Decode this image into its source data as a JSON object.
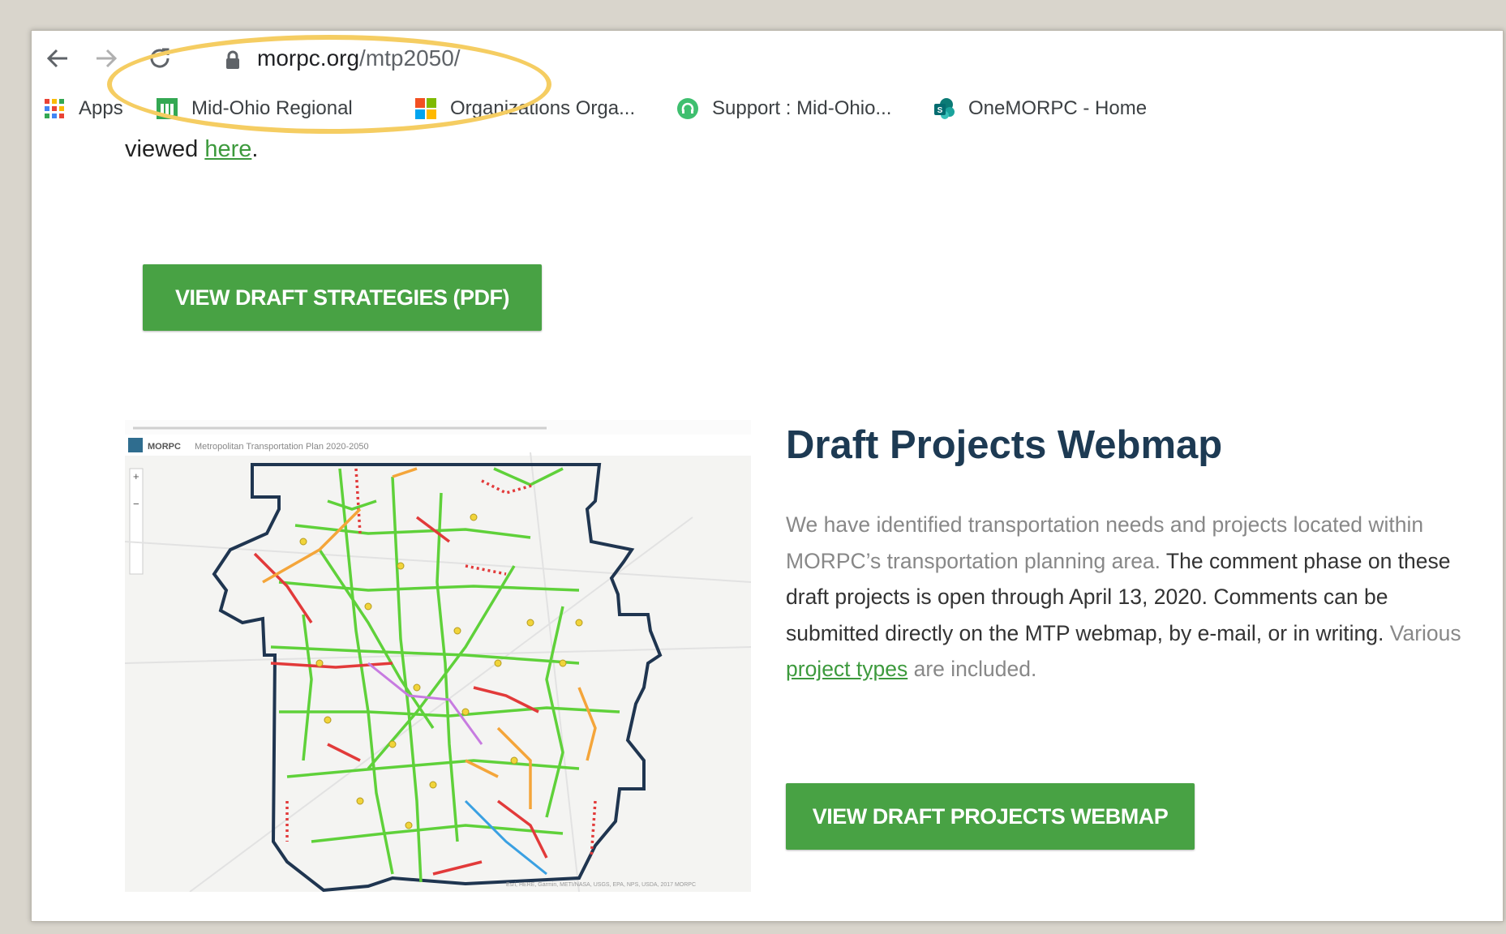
{
  "browser": {
    "url_host": "morpc.org",
    "url_path": "/mtp2050/",
    "highlight_color": "#f5cd62"
  },
  "bookmarks": [
    {
      "label": "Apps",
      "icon": "apps-grid-icon"
    },
    {
      "label": "Mid-Ohio Regional",
      "icon": "sheet-icon"
    },
    {
      "label": "Organizations Orga...",
      "icon": "windows-logo-icon"
    },
    {
      "label": "Support : Mid-Ohio...",
      "icon": "headset-icon"
    },
    {
      "label": "OneMORPC - Home",
      "icon": "sharepoint-icon"
    }
  ],
  "content": {
    "viewed_prefix": "viewed ",
    "viewed_link": "here",
    "viewed_suffix": ".",
    "strategies_button": "VIEW DRAFT STRATEGIES (PDF)",
    "heading": "Draft Projects Webmap",
    "para_1": "We have identified transportation needs and projects located within MORPC’s transportation planning area. ",
    "para_2": "The comment phase on these draft projects is open through April 13, 2020. Comments can be submitted directly on the MTP webmap, by e-mail, or in writing. ",
    "para_3": "Various ",
    "para_link": "project types",
    "para_4": " are included.",
    "webmap_button": "VIEW DRAFT PROJECTS WEBMAP"
  },
  "map": {
    "brand": "MORPC",
    "title": "Metropolitan Transportation Plan 2020-2050",
    "attribution": "Esri, HERE, Garmin, METI/NASA, USGS, EPA, NPS, USDA, 2017 MORPC",
    "colors": {
      "green": "#5fd13a",
      "red": "#e23a3a",
      "orange": "#f4a53a",
      "purple": "#c77be0",
      "blue": "#3aa0e2",
      "yellow": "#f1d43a",
      "boundary": "#1f3550"
    }
  }
}
